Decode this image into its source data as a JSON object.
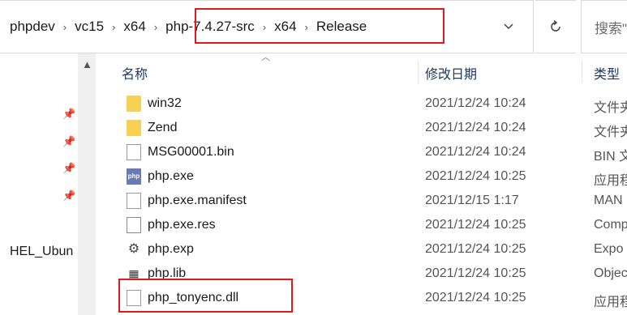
{
  "address": {
    "breadcrumbs": [
      "phpdev",
      "vc15",
      "x64",
      "php-7.4.27-src",
      "x64",
      "Release"
    ],
    "separator": "›",
    "search_placeholder": "搜索\""
  },
  "nav": {
    "item": "HEL_Ubun"
  },
  "columns": {
    "name": "名称",
    "date": "修改日期",
    "type": "类型"
  },
  "files": [
    {
      "name": "win32",
      "date": "2021/12/24 10:24",
      "type": "文件夹",
      "icon": "folder-icon"
    },
    {
      "name": "Zend",
      "date": "2021/12/24 10:24",
      "type": "文件夹",
      "icon": "folder-icon"
    },
    {
      "name": "MSG00001.bin",
      "date": "2021/12/24 10:24",
      "type": "BIN 文",
      "icon": "file-icon"
    },
    {
      "name": "php.exe",
      "date": "2021/12/24 10:25",
      "type": "应用程",
      "icon": "php-exe-icon"
    },
    {
      "name": "php.exe.manifest",
      "date": "2021/12/15 1:17",
      "type": "MAN",
      "icon": "file-icon"
    },
    {
      "name": "php.exe.res",
      "date": "2021/12/24 10:25",
      "type": "Comp",
      "icon": "resource-file-icon"
    },
    {
      "name": "php.exp",
      "date": "2021/12/24 10:25",
      "type": "Expo",
      "icon": "export-file-icon"
    },
    {
      "name": "php.lib",
      "date": "2021/12/24 10:25",
      "type": "Objec",
      "icon": "library-file-icon"
    },
    {
      "name": "php_tonyenc.dll",
      "date": "2021/12/24 10:25",
      "type": "应用程",
      "icon": "dll-file-icon"
    }
  ],
  "colors": {
    "highlight": "#e0191f",
    "folder": "#f7d155",
    "header_text": "#1f3864"
  }
}
